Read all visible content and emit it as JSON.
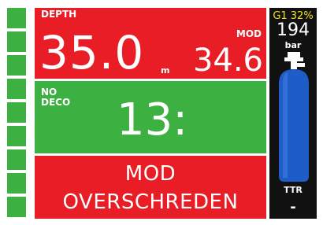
{
  "colors": {
    "alarm_red": "#e81d25",
    "ok_green": "#3cb040",
    "gas_yellow": "#f0e020",
    "tank_blue": "#1e5cc8",
    "background": "#ffffff",
    "side_panel": "#111111"
  },
  "depth": {
    "label": "DEPTH",
    "value": "35.0",
    "unit": "m",
    "mod_label": "MOD",
    "mod_value": "34.6"
  },
  "deco": {
    "label_line1": "NO",
    "label_line2": "DECO",
    "ndl_value": "13:"
  },
  "warning": {
    "line1": "MOD",
    "line2": "OVERSCHREDEN"
  },
  "gas": {
    "name": "G1 32%",
    "pressure": "194",
    "pressure_unit": "bar",
    "tank_icon": "gas-cylinder-icon",
    "ttr_label": "TTR",
    "ttr_value": "-"
  },
  "left_bar": {
    "segment_count": 9
  }
}
